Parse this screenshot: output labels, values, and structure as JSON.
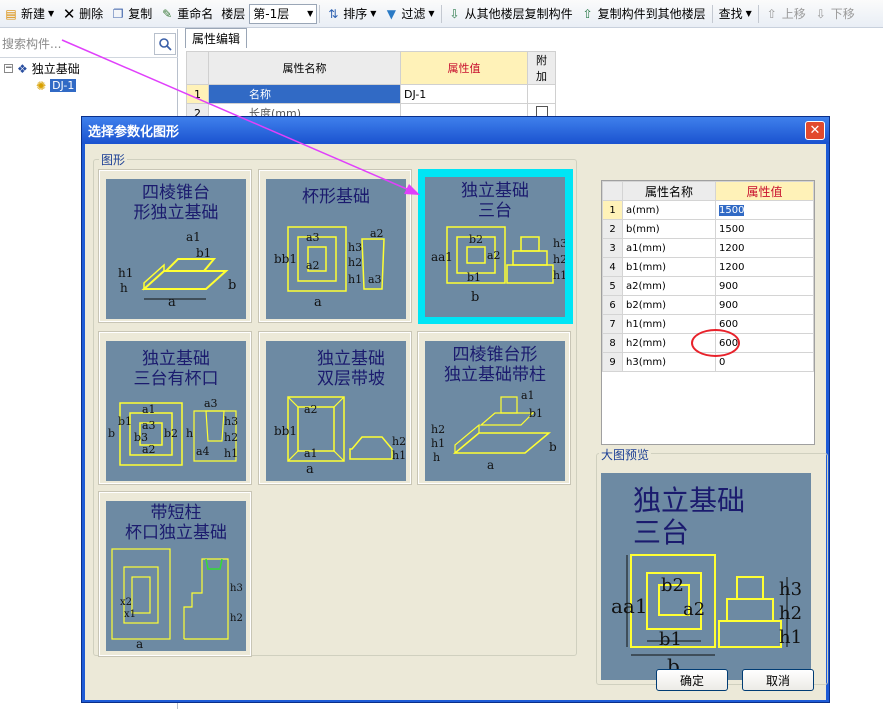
{
  "toolbar": {
    "new": "新建",
    "delete": "删除",
    "copy": "复制",
    "rename": "重命名",
    "floor_label": "楼层",
    "floor_value": "第-1层",
    "sort": "排序",
    "filter": "过滤",
    "copy_from_floor": "从其他楼层复制构件",
    "copy_to_floor": "复制构件到其他楼层",
    "find": "查找",
    "move_up": "上移",
    "move_down": "下移"
  },
  "search": {
    "placeholder": "搜索构件..."
  },
  "tree": {
    "root": "独立基础",
    "child": "DJ-1"
  },
  "props_tab": "属性编辑",
  "props": {
    "headers": [
      "属性名称",
      "属性值",
      "附加"
    ],
    "rows": [
      {
        "num": "1",
        "name": "名称",
        "value": "DJ-1"
      },
      {
        "num": "2",
        "name": "长度(mm)",
        "value": ""
      }
    ]
  },
  "dialog": {
    "title": "选择参数化图形",
    "group_shapes": "图形",
    "group_preview": "大图预览",
    "ok": "确定",
    "cancel": "取消",
    "shapes": [
      {
        "title": "四棱锥台\n形独立基础"
      },
      {
        "title": "杯形基础"
      },
      {
        "title": "独立基础\n三台"
      },
      {
        "title": "独立基础\n三台有杯口"
      },
      {
        "title": "独立基础\n双层带坡"
      },
      {
        "title": "四棱锥台形\n独立基础带柱"
      },
      {
        "title": "带短柱\n杯口独立基础"
      }
    ],
    "selected_index": 2,
    "param_headers": [
      "属性名称",
      "属性值"
    ],
    "params": [
      {
        "num": "1",
        "name": "a(mm)",
        "value": "1500"
      },
      {
        "num": "2",
        "name": "b(mm)",
        "value": "1500"
      },
      {
        "num": "3",
        "name": "a1(mm)",
        "value": "1200"
      },
      {
        "num": "4",
        "name": "b1(mm)",
        "value": "1200"
      },
      {
        "num": "5",
        "name": "a2(mm)",
        "value": "900"
      },
      {
        "num": "6",
        "name": "b2(mm)",
        "value": "900"
      },
      {
        "num": "7",
        "name": "h1(mm)",
        "value": "600"
      },
      {
        "num": "8",
        "name": "h2(mm)",
        "value": "600"
      },
      {
        "num": "9",
        "name": "h3(mm)",
        "value": "0"
      }
    ],
    "preview_title": "独立基础\n三台"
  },
  "colors": {
    "titlebar": "#1a52cf",
    "selection": "#316ac5",
    "card_highlight": "#00e5f5",
    "annotation": "#e8222b",
    "arrow": "#e040fb"
  }
}
